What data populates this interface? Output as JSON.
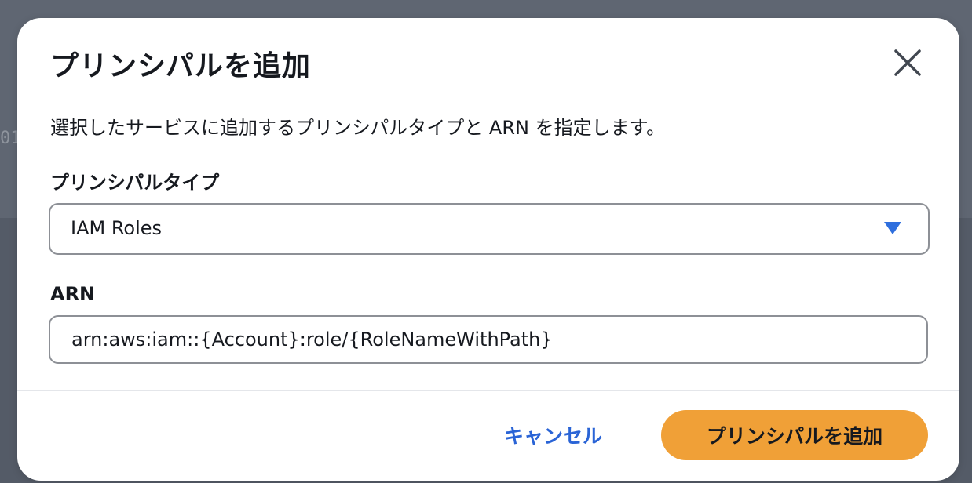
{
  "background": {
    "fragment": "01"
  },
  "modal": {
    "title": "プリンシパルを追加",
    "description": "選択したサービスに追加するプリンシパルタイプと ARN を指定します。",
    "principal_type": {
      "label": "プリンシパルタイプ",
      "selected": "IAM Roles",
      "caret_icon": "caret-down-icon"
    },
    "arn": {
      "label": "ARN",
      "value": "arn:aws:iam::{Account}:role/{RoleNameWithPath}"
    },
    "footer": {
      "cancel_label": "キャンセル",
      "submit_label": "プリンシパルを追加"
    },
    "close_icon": "close-icon"
  },
  "colors": {
    "accent": "#f0a037",
    "link": "#2a64d6",
    "caret": "#2f6fde",
    "overlay": "#5f6672"
  }
}
